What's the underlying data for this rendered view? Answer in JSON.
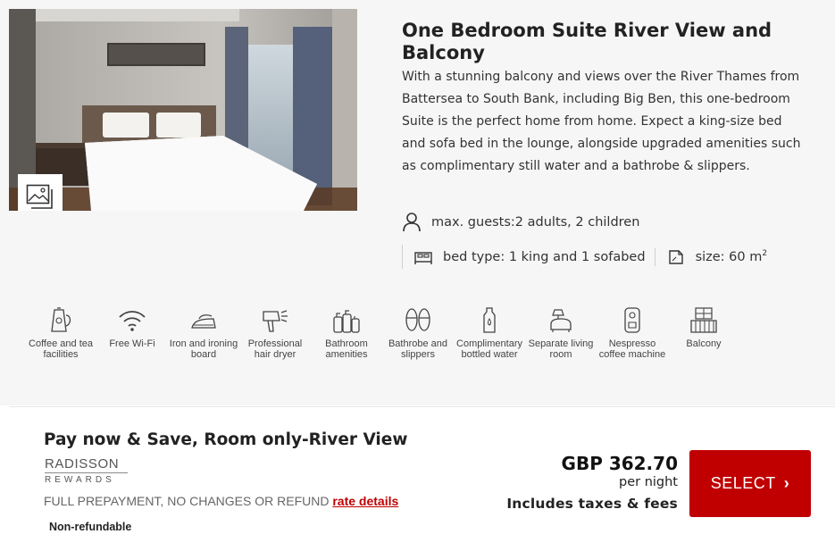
{
  "room": {
    "title": "One Bedroom Suite River View and Balcony",
    "description": "With a stunning balcony and views over the River Thames from Battersea to South Bank, including Big Ben, this one-bedroom Suite is the perfect home from home. Expect a king-size bed and sofa bed in the lounge, alongside upgraded amenities such as complimentary still water and a bathrobe & slippers.",
    "guests": "max. guests:2 adults, 2 children",
    "bed_type": "bed type: 1 king and 1 sofabed",
    "size_prefix": "size: 60 m",
    "size_sup": "2",
    "gallery_icon": "image-gallery-icon"
  },
  "amenities": [
    {
      "label": "Coffee and tea facilities",
      "icon": "kettle-icon"
    },
    {
      "label": "Free Wi-Fi",
      "icon": "wifi-icon"
    },
    {
      "label": "Iron and ironing board",
      "icon": "iron-icon"
    },
    {
      "label": "Professional hair dryer",
      "icon": "hair-dryer-icon"
    },
    {
      "label": "Bathroom amenities",
      "icon": "toiletries-icon"
    },
    {
      "label": "Bathrobe and slippers",
      "icon": "slippers-icon"
    },
    {
      "label": "Complimentary bottled water",
      "icon": "water-bottle-icon"
    },
    {
      "label": "Separate living room",
      "icon": "living-room-icon"
    },
    {
      "label": "Nespresso coffee machine",
      "icon": "coffee-machine-icon"
    },
    {
      "label": "Balcony",
      "icon": "balcony-icon"
    }
  ],
  "rate": {
    "title": "Pay now & Save, Room only-River View",
    "rewards_top": "RADISSON",
    "rewards_bottom": "REWARDS",
    "policy": "FULL PREPAYMENT, NO CHANGES OR REFUND",
    "details_link": "rate details",
    "refund": "Non-refundable",
    "price": "GBP 362.70",
    "per_night": "per night",
    "taxes": "Includes taxes & fees",
    "select_label": "SELECT",
    "select_chevron": "›"
  },
  "colors": {
    "accent": "#c00000",
    "card_bg": "#f6f6f6"
  }
}
